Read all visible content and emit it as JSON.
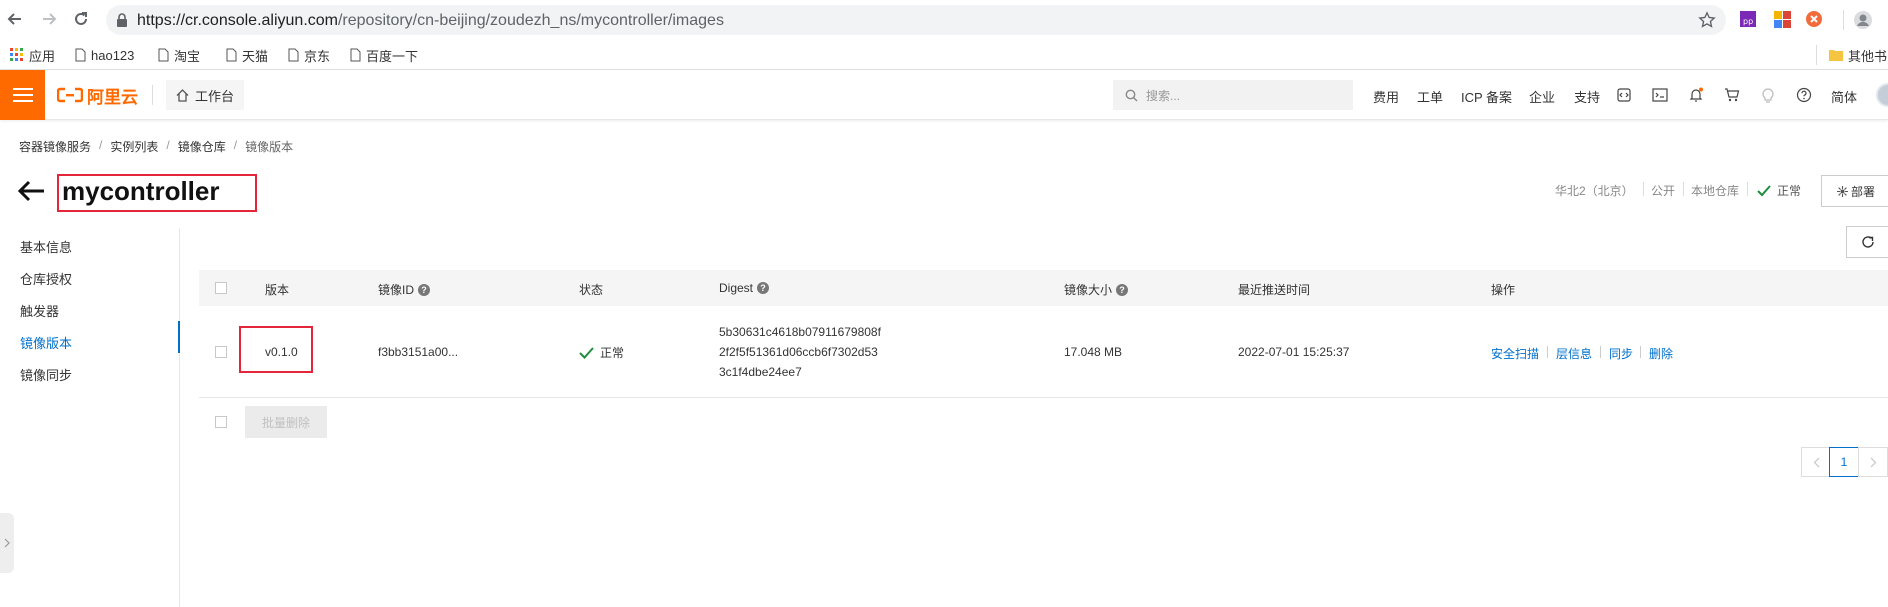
{
  "browser": {
    "url_host": "https://cr.console.aliyun.com",
    "url_path": "/repository/cn-beijing/zoudezh_ns/mycontroller/images",
    "bookmarks": [
      "应用",
      "hao123",
      "淘宝",
      "天猫",
      "京东",
      "百度一下"
    ],
    "other_bookmarks": "其他书"
  },
  "header": {
    "logo": "阿里云",
    "workbench": "工作台",
    "search_placeholder": "搜索...",
    "links": [
      "费用",
      "工单",
      "ICP 备案",
      "企业",
      "支持"
    ],
    "lang": "简体"
  },
  "breadcrumb": [
    "容器镜像服务",
    "实例列表",
    "镜像仓库",
    "镜像版本"
  ],
  "page": {
    "title": "mycontroller",
    "region": "华北2（北京）",
    "visibility": "公开",
    "repo_type": "本地仓库",
    "status": "正常",
    "deploy_label": "部署"
  },
  "menu": [
    "基本信息",
    "仓库授权",
    "触发器",
    "镜像版本",
    "镜像同步"
  ],
  "table": {
    "headers": {
      "version": "版本",
      "image_id": "镜像ID",
      "status": "状态",
      "digest": "Digest",
      "size": "镜像大小",
      "pushed": "最近推送时间",
      "ops": "操作"
    },
    "rows": [
      {
        "version": "v0.1.0",
        "image_id": "f3bb3151a00...",
        "status": "正常",
        "digest_lines": [
          "5b30631c4618b07911679808f",
          "2f2f5f51361d06ccb6f7302d53",
          "3c1f4dbe24ee7"
        ],
        "size": "17.048 MB",
        "pushed": "2022-07-01 15:25:37",
        "ops": [
          "安全扫描",
          "层信息",
          "同步",
          "删除"
        ]
      }
    ],
    "batch_delete": "批量删除",
    "current_page": "1"
  },
  "colors": {
    "brand": "#ff6a00",
    "link": "#0070cc",
    "highlight_box": "#e3263a",
    "success": "#1e8e3e"
  }
}
